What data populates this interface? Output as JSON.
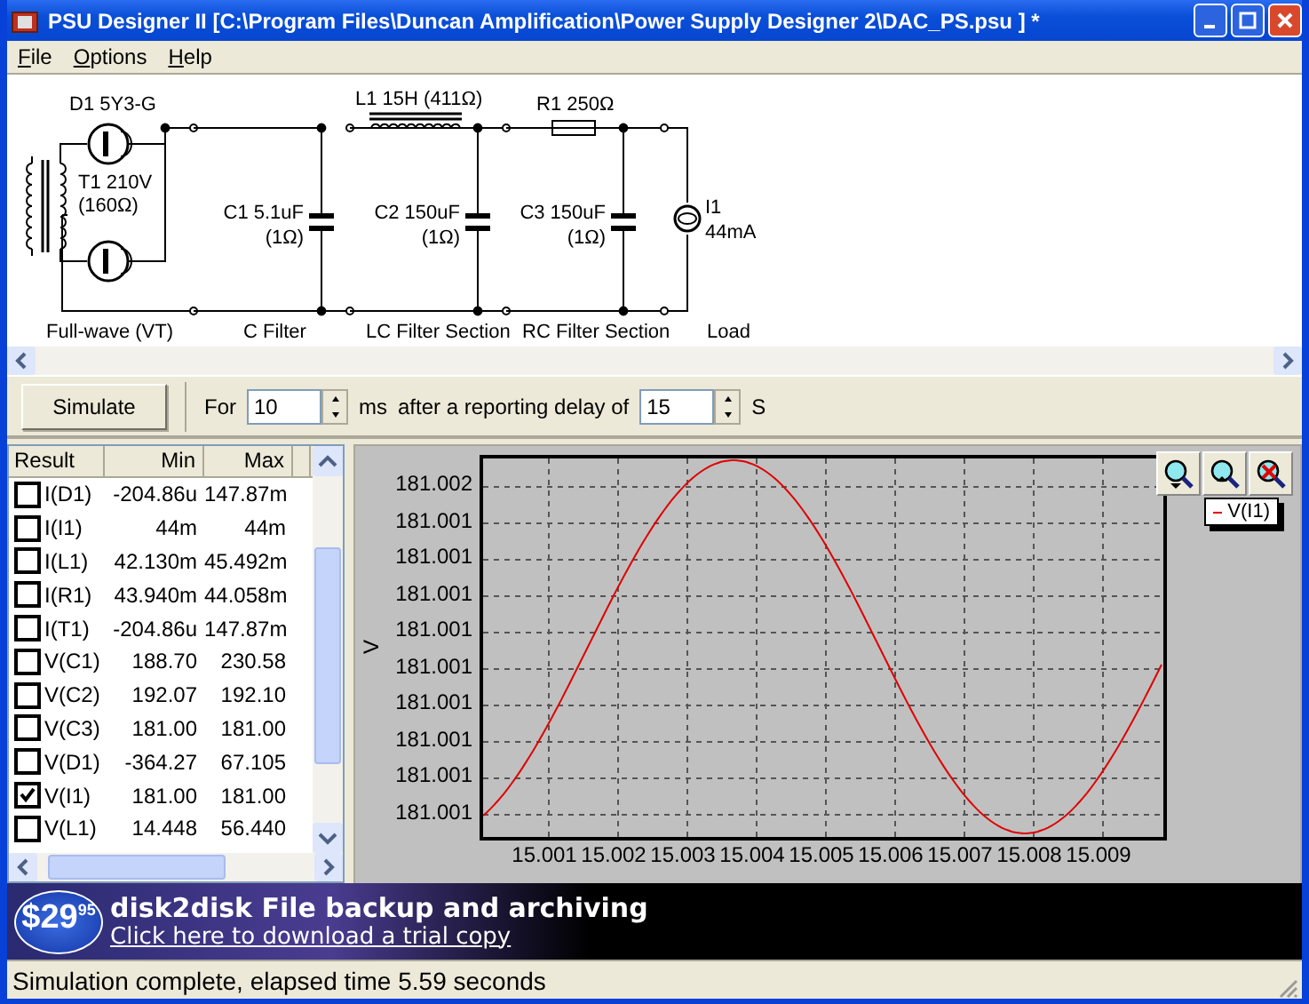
{
  "window": {
    "title": "PSU Designer II  [C:\\Program Files\\Duncan Amplification\\Power Supply Designer 2\\DAC_PS.psu ] *"
  },
  "menu": [
    {
      "label": "File"
    },
    {
      "label": "Options"
    },
    {
      "label": "Help"
    }
  ],
  "schematic": {
    "sections": [
      {
        "kind": "fullwave",
        "label": "Full-wave (VT)",
        "parts": [
          {
            "kind": "rectifier",
            "name": "D1 5Y3-G"
          },
          {
            "kind": "transformer",
            "name": "T1 210V",
            "value": "(160Ω)"
          }
        ]
      },
      {
        "kind": "c_filter",
        "label": "C Filter",
        "parts": [
          {
            "kind": "capacitor",
            "name": "C1 5.1uF",
            "value": "(1Ω)"
          }
        ]
      },
      {
        "kind": "lc_filter",
        "label": "LC Filter Section",
        "parts": [
          {
            "kind": "inductor",
            "name": "L1 15H (411Ω)"
          },
          {
            "kind": "capacitor",
            "name": "C2 150uF",
            "value": "(1Ω)"
          }
        ]
      },
      {
        "kind": "rc_filter",
        "label": "RC Filter Section",
        "parts": [
          {
            "kind": "resistor",
            "name": "R1 250Ω"
          },
          {
            "kind": "capacitor",
            "name": "C3 150uF",
            "value": "(1Ω)"
          }
        ]
      },
      {
        "kind": "load",
        "label": "Load",
        "parts": [
          {
            "kind": "current_source",
            "name": "I1",
            "value": "44mA"
          }
        ]
      }
    ]
  },
  "simulation": {
    "button": "Simulate",
    "for_label": "For",
    "duration": "10",
    "duration_unit": "ms",
    "delay_label": "after a reporting delay of",
    "delay": "15",
    "delay_unit": "S"
  },
  "results": {
    "columns": [
      "Result",
      "Min",
      "Max"
    ],
    "rows": [
      {
        "checked": false,
        "result": "I(D1)",
        "min": "-204.86u",
        "max": "147.87m"
      },
      {
        "checked": false,
        "result": "I(I1)",
        "min": "44m",
        "max": "44m"
      },
      {
        "checked": false,
        "result": "I(L1)",
        "min": "42.130m",
        "max": "45.492m"
      },
      {
        "checked": false,
        "result": "I(R1)",
        "min": "43.940m",
        "max": "44.058m"
      },
      {
        "checked": false,
        "result": "I(T1)",
        "min": "-204.86u",
        "max": "147.87m"
      },
      {
        "checked": false,
        "result": "V(C1)",
        "min": "188.70",
        "max": "230.58"
      },
      {
        "checked": false,
        "result": "V(C2)",
        "min": "192.07",
        "max": "192.10"
      },
      {
        "checked": false,
        "result": "V(C3)",
        "min": "181.00",
        "max": "181.00"
      },
      {
        "checked": false,
        "result": "V(D1)",
        "min": "-364.27",
        "max": "67.105"
      },
      {
        "checked": true,
        "result": "V(I1)",
        "min": "181.00",
        "max": "181.00"
      },
      {
        "checked": false,
        "result": "V(L1)",
        "min": "14.448",
        "max": "56.440"
      }
    ]
  },
  "plot": {
    "ylabel": "V",
    "yticks": [
      "181.002",
      "181.001",
      "181.001",
      "181.001",
      "181.001",
      "181.001",
      "181.001",
      "181.001",
      "181.001",
      "181.001"
    ],
    "xticks": [
      "15.001",
      "15.002",
      "15.003",
      "15.004",
      "15.005",
      "15.006",
      "15.007",
      "15.008",
      "15.009"
    ],
    "legend": [
      {
        "label": "V(I1)",
        "color": "#e00000"
      }
    ]
  },
  "banner": {
    "price_dollars": "$29",
    "price_cents": "95",
    "headline": "disk2disk File backup and archiving",
    "link": "Click here to download a trial copy"
  },
  "status_bar": {
    "text": "Simulation complete, elapsed time 5.59 seconds"
  }
}
